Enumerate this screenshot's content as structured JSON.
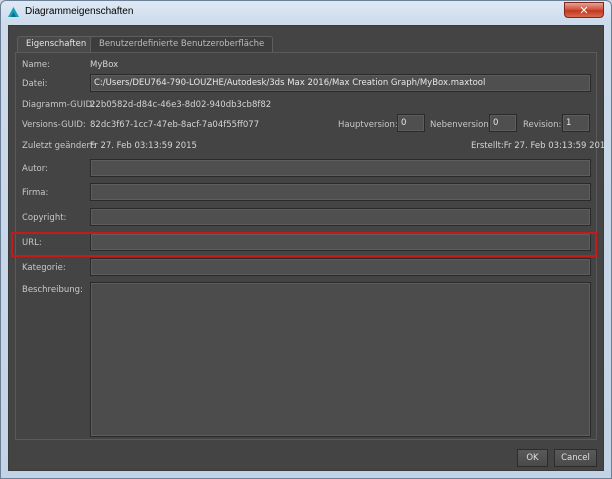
{
  "window": {
    "title": "Diagrammeigenschaften"
  },
  "tabs": [
    {
      "label": "Eigenschaften"
    },
    {
      "label": "Benutzerdefinierte Benutzeroberfläche"
    }
  ],
  "fields": {
    "name_label": "Name:",
    "name_value": "MyBox",
    "datei_label": "Datei:",
    "datei_value": "C:/Users/DEU764-790-LOUZHE/Autodesk/3ds Max 2016/Max Creation Graph/MyBox.maxtool",
    "guid_label": "Diagramm-GUID:",
    "guid_value": "22b0582d-d84c-46e3-8d02-940db3cb8f82",
    "version_guid_label": "Versions-GUID:",
    "version_guid_value": "82dc3f67-1cc7-47eb-8acf-7a04f55ff077",
    "hauptversion_label": "Hauptversion:",
    "hauptversion_value": "0",
    "nebenversion_label": "Nebenversion:",
    "nebenversion_value": "0",
    "revision_label": "Revision:",
    "revision_value": "1",
    "modified_label": "Zuletzt geändert:",
    "modified_value": "Fr 27. Feb 03:13:59 2015",
    "created_text": "Erstellt:Fr 27. Feb 03:13:59 2015",
    "autor_label": "Autor:",
    "autor_value": "",
    "firma_label": "Firma:",
    "firma_value": "",
    "copyright_label": "Copyright:",
    "copyright_value": "",
    "url_label": "URL:",
    "url_value": "",
    "kategorie_label": "Kategorie:",
    "kategorie_value": "",
    "beschreibung_label": "Beschreibung:"
  },
  "buttons": {
    "ok": "OK",
    "cancel": "Cancel"
  },
  "icons": {
    "app": "3ds-max-app-icon",
    "close": "close-icon"
  },
  "colors": {
    "highlight": "#c41a1a",
    "dialog_bg": "#444444"
  }
}
